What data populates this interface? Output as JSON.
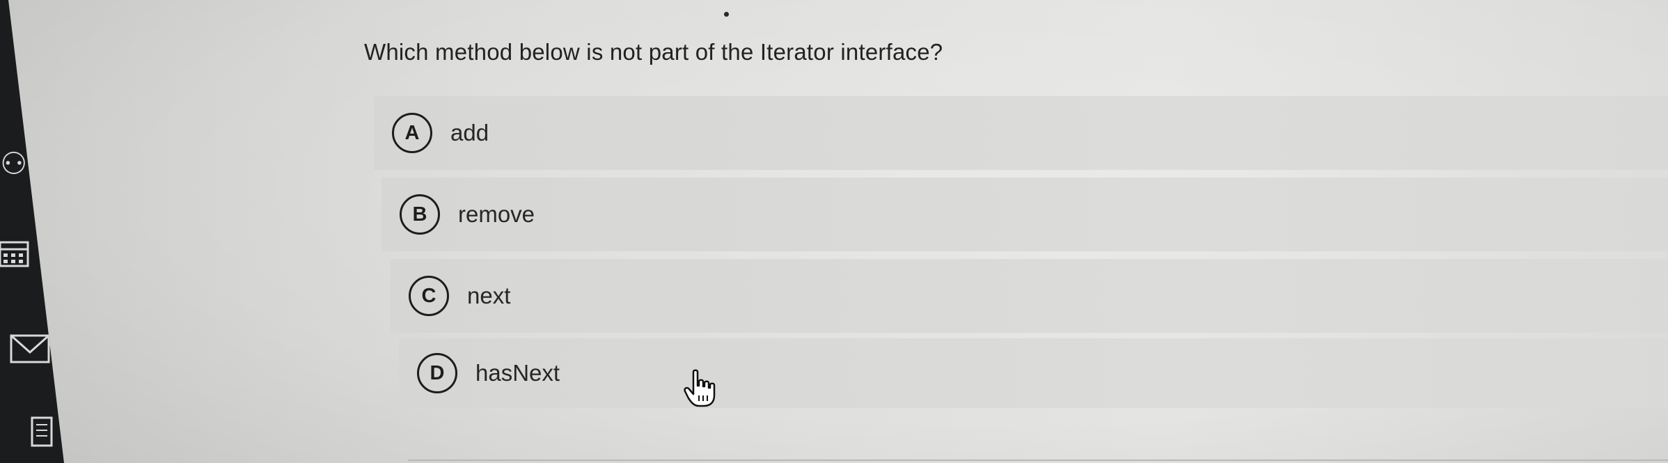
{
  "question": {
    "text": "Which method below is not part of the Iterator interface?"
  },
  "options": [
    {
      "letter": "A",
      "label": "add"
    },
    {
      "letter": "B",
      "label": "remove"
    },
    {
      "letter": "C",
      "label": "next"
    },
    {
      "letter": "D",
      "label": "hasNext"
    }
  ],
  "sidebar": {
    "icons": [
      "people-icon",
      "calendar-icon",
      "mail-icon",
      "document-icon"
    ]
  },
  "cursor": {
    "icon": "hand-pointer-icon"
  },
  "colors": {
    "text": "#222222",
    "option_background": "#d9d9d7",
    "badge_border": "#1d1d1d"
  }
}
